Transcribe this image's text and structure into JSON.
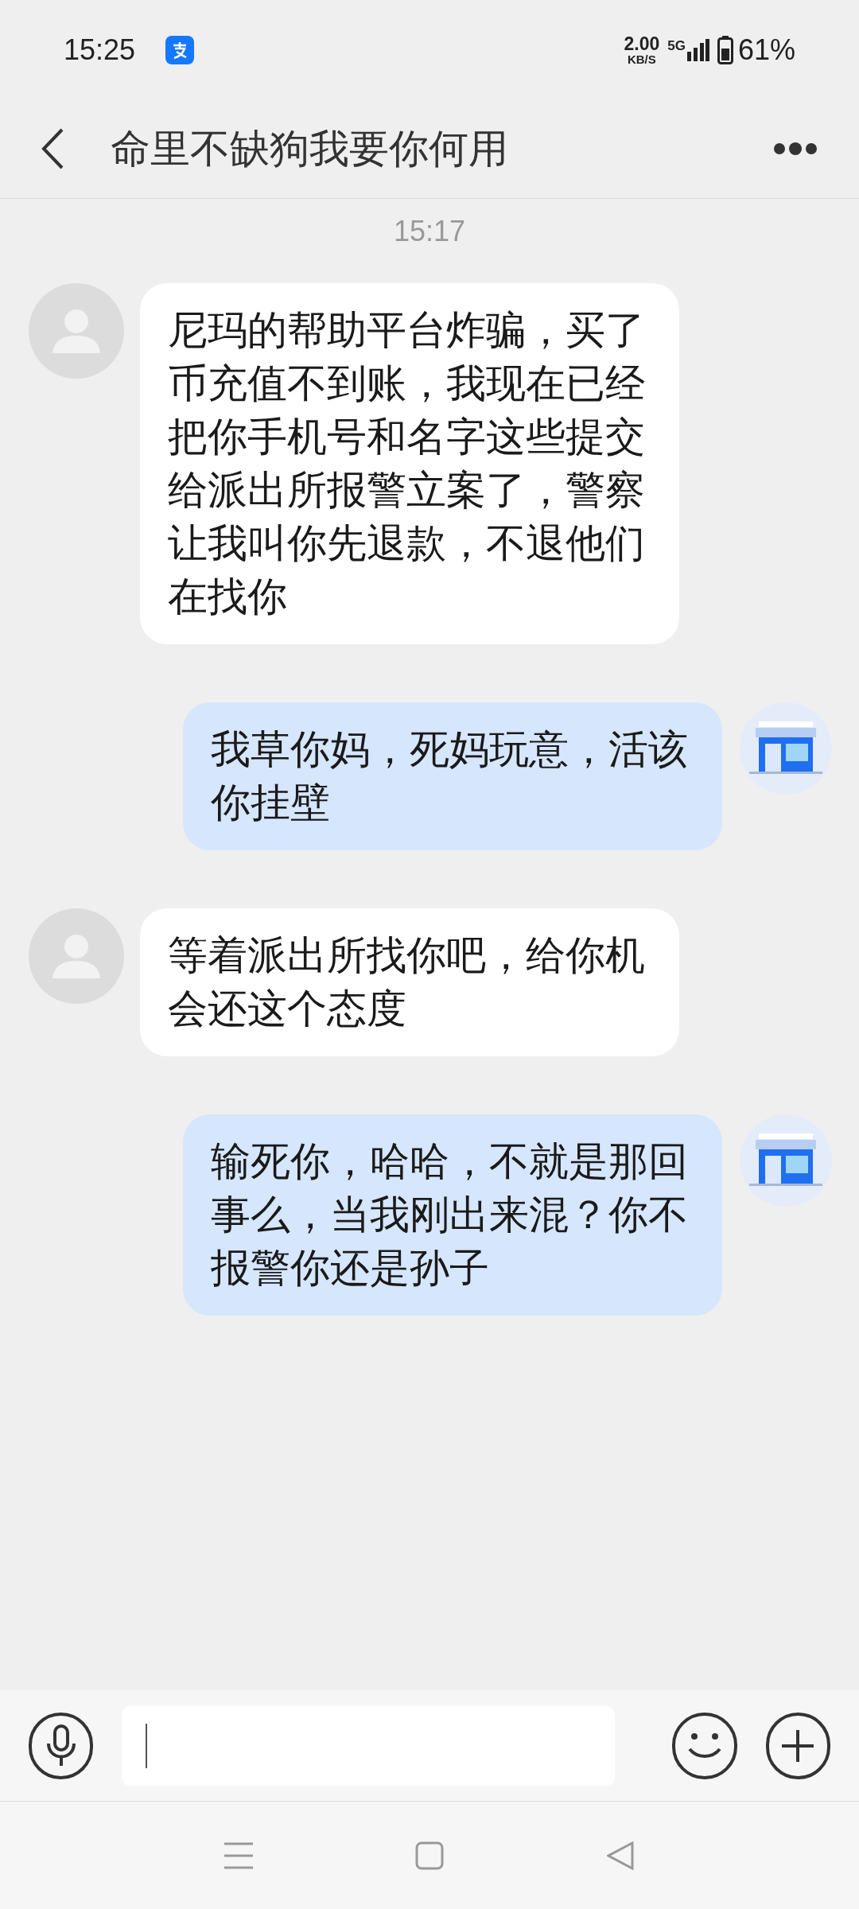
{
  "status_bar": {
    "time": "15:25",
    "speed": "2.00",
    "speed_unit": "KB/S",
    "network": "5G",
    "battery": "61%"
  },
  "header": {
    "title": "命里不缺狗我要你何用"
  },
  "timestamp": "15:17",
  "messages": [
    {
      "kind": "incoming",
      "text": "尼玛的帮助平台炸骗，买了币充值不到账，我现在已经把你手机号和名字这些提交给派出所报警立案了，警察让我叫你先退款，不退他们在找你"
    },
    {
      "kind": "outgoing",
      "text": "我草你妈，死妈玩意，活该你挂壁"
    },
    {
      "kind": "incoming",
      "text": "等着派出所找你吧，给你机会还这个态度"
    },
    {
      "kind": "outgoing",
      "text": "输死你，哈哈，不就是那回事么，当我刚出来混？你不报警你还是孙子"
    }
  ]
}
